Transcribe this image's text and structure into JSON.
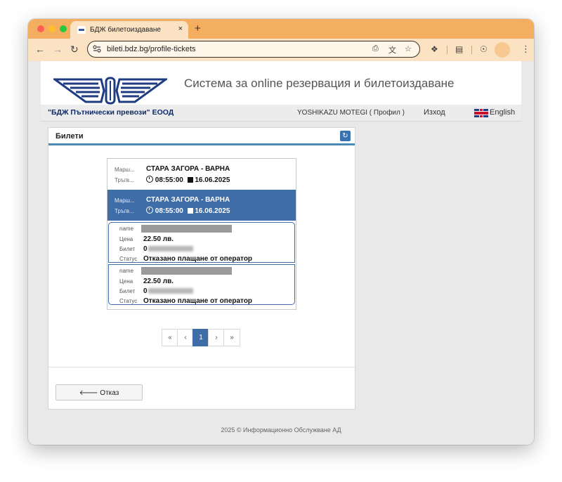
{
  "browser": {
    "tab_title": "БДЖ билетоиздаване",
    "tab_close": "×",
    "new_tab": "+",
    "url": "bileti.bdz.bg/profile-tickets",
    "icons": [
      "back-arrow-icon",
      "forward-arrow-icon",
      "reload-icon",
      "site-info-icon",
      "install-icon",
      "translate-icon",
      "bookmark-star-icon",
      "extensions-icon",
      "reading-list-icon",
      "side-panel-icon",
      "menu-icon"
    ]
  },
  "header": {
    "site_title": "Система за online резервация и билетоиздаване",
    "company": "\"БДЖ Пътнически превози\" ЕООД",
    "user": "YOSHIKAZU MOTEGI ( Профил )",
    "logout": "Изход",
    "language": "English"
  },
  "panel": {
    "title": "Билети",
    "cancel_label": "Отказ",
    "cancel_icon": "🡐"
  },
  "trips": [
    {
      "route_label": "Марш...",
      "dep_label": "Тръгв...",
      "route": "СТАРА ЗАГОРА - ВАРНА",
      "time": "08:55:00",
      "date": "16.06.2025"
    },
    {
      "route_label": "Марш...",
      "dep_label": "Тръгв...",
      "route": "СТАРА ЗАГОРА - ВАРНА",
      "time": "08:55:00",
      "date": "16.06.2025"
    }
  ],
  "tickets": [
    {
      "name_label": "name",
      "price_label": "Цена",
      "price": "22.50 лв.",
      "ticket_label": "Билет",
      "ticket_prefix": "0",
      "status_label": "Статус",
      "status": "Отказано плащане от оператор"
    },
    {
      "name_label": "name",
      "price_label": "Цена",
      "price": "22.50 лв.",
      "ticket_label": "Билет",
      "ticket_prefix": "0",
      "status_label": "Статус",
      "status": "Отказано плащане от оператор"
    }
  ],
  "pagination": {
    "first": "«",
    "prev": "‹",
    "current": "1",
    "next": "›",
    "last": "»"
  },
  "footer": "2025 © Информационно Обслужване АД",
  "colors": {
    "titlebar": "#f4ae5f",
    "toolbar": "#fbe2c2",
    "accent": "#3e6da8",
    "logo_blue": "#1f3c82"
  }
}
